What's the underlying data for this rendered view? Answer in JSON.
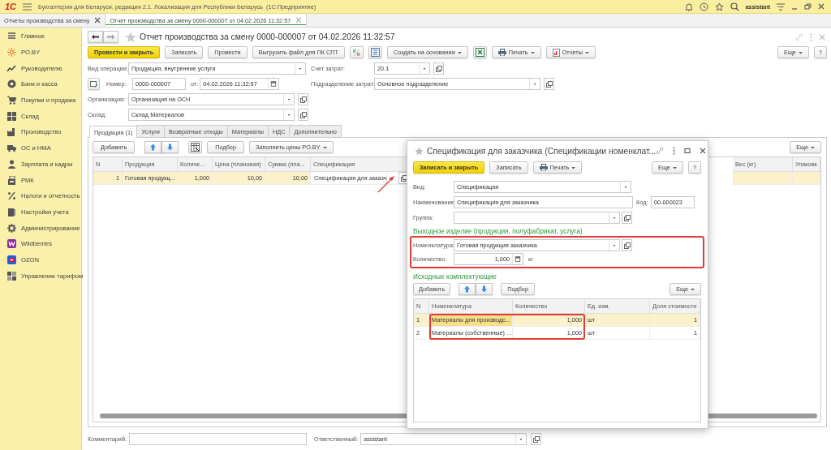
{
  "app": {
    "logo": "1С",
    "title": "Бухгалтерия для Беларуси, редакция 2.1. Локализация для Республики Беларусь  (1С:Предприятие)",
    "user": "assistant"
  },
  "open_tabs": [
    {
      "label": "Отчеты производства за смену",
      "selected": false
    },
    {
      "label": "Отчет производства за смену 0000-000007 от 04.02.2026 11:32:57",
      "selected": true
    }
  ],
  "sidebar": {
    "items": [
      {
        "label": "Главное"
      },
      {
        "label": "PO.BY"
      },
      {
        "label": "Руководителю"
      },
      {
        "label": "Банк и касса"
      },
      {
        "label": "Покупки и продажи"
      },
      {
        "label": "Склад"
      },
      {
        "label": "Производство"
      },
      {
        "label": "ОС и НМА"
      },
      {
        "label": "Зарплата и кадры"
      },
      {
        "label": "РМК"
      },
      {
        "label": "Налоги и отчетность"
      },
      {
        "label": "Настройки учета"
      },
      {
        "label": "Администрирование"
      },
      {
        "label": "Wildberries"
      },
      {
        "label": "OZON"
      },
      {
        "label": "Управление тарифом"
      }
    ]
  },
  "document": {
    "title": "Отчет производства за смену 0000-000007 от 04.02.2026 11:32:57",
    "toolbar": [
      {
        "kind": "primary",
        "label": "Провести и закрыть"
      },
      {
        "kind": "plain",
        "label": "Записать"
      },
      {
        "kind": "plain",
        "label": "Провести"
      },
      {
        "kind": "plain",
        "label": "Выгрузить файл для ПК СПТ"
      },
      {
        "kind": "icon"
      },
      {
        "kind": "icon"
      },
      {
        "kind": "menu",
        "label": "Создать на основании"
      },
      {
        "kind": "icon"
      },
      {
        "kind": "menu",
        "label": "Печать"
      },
      {
        "kind": "menu",
        "label": "Отчеты"
      }
    ],
    "more_button": "Еще",
    "help_button": "?",
    "fields": {
      "operation": {
        "label": "Вид операции:",
        "value": "Продукция, внутренние услуги"
      },
      "number": {
        "label": "Номер:",
        "value": "0000-000007"
      },
      "date": {
        "label": "от:",
        "value": "04.02.2026 11:32:57"
      },
      "organization": {
        "label": "Организация:",
        "value": "Организация на ОСН"
      },
      "warehouse": {
        "label": "Склад:",
        "value": "Склад Материалов"
      },
      "cost_account": {
        "label": "Счет затрат:",
        "value": "20.1"
      },
      "cost_department": {
        "label": "Подразделение затрат:",
        "value": "Основное подразделение"
      }
    },
    "tabs": [
      {
        "label": "Продукция (1)",
        "selected": true
      },
      {
        "label": "Услуги",
        "selected": false
      },
      {
        "label": "Возвратные отходы",
        "selected": false
      },
      {
        "label": "Материалы",
        "selected": false
      },
      {
        "label": "НДС",
        "selected": false
      },
      {
        "label": "Дополнительно",
        "selected": false
      }
    ],
    "table_toolbar": {
      "add": "Добавить",
      "pick": "Подбор",
      "fill_prices": "Заполнить цены PO.BY",
      "more": "Еще"
    },
    "table": {
      "columns": [
        "N",
        "Продукция",
        "Количе...",
        "Цена (плановая)",
        "Сумма (пла...",
        "Спецификация",
        "Вес (кг)",
        "Упаковк"
      ],
      "rows": [
        {
          "selected": true,
          "arrow": true,
          "cells": [
            "1",
            "Готовая продукц...",
            "1,000",
            "10,00",
            "10,00"
          ],
          "specification": "Спецификация для заказч"
        }
      ]
    },
    "comment": {
      "label": "Комментарий:"
    },
    "responsible": {
      "label": "Ответственный:",
      "value": "assistant"
    }
  },
  "dialog": {
    "title": "Спецификация для заказчика (Спецификации номенклат...",
    "toolbar": [
      {
        "kind": "primary",
        "label": "Записать и закрыть"
      },
      {
        "kind": "plain",
        "label": "Записать"
      },
      {
        "kind": "menu",
        "label": "Печать"
      }
    ],
    "more_button": "Еще",
    "help_button": "?",
    "fields": {
      "type": {
        "label": "Вид:",
        "value": "Спецификация"
      },
      "name": {
        "label": "Наименование:",
        "value": "Спецификация для заказчика"
      },
      "code": {
        "label": "Код:",
        "value": "00-000023"
      },
      "group": {
        "label": "Группа:"
      }
    },
    "output_section": {
      "heading": "Выходное изделие (продукция, полуфабрикат, услуга)",
      "highlighted": true,
      "nomenclature": {
        "label": "Номенклатура:",
        "value": "Готовая продукция заказчика"
      },
      "quantity": {
        "label": "Количество:",
        "value": "1,000",
        "unit": "кг"
      }
    },
    "components": {
      "heading": "Исходные комплектующие",
      "highlighted": true,
      "toolbar": {
        "add": "Добавить",
        "pick": "Подбор",
        "more": "Еще"
      },
      "columns": [
        "N",
        "Номенклатура",
        "Количество",
        "Ед. изм.",
        "Доля стоимости"
      ],
      "rows": [
        {
          "selected": true,
          "cells": [
            "1",
            "Материалы для производс...",
            "1,000",
            "шт",
            "1"
          ]
        },
        {
          "selected": false,
          "cells": [
            "2",
            "Материалы (собственные) ...",
            "1,000",
            "шт",
            "1"
          ]
        }
      ]
    }
  }
}
